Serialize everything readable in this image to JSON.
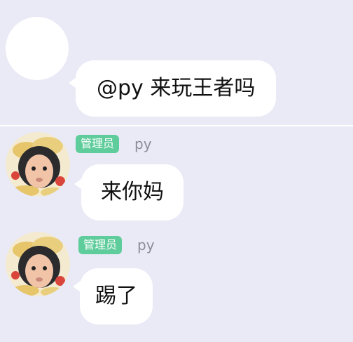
{
  "colors": {
    "background": "#e9eaf6",
    "bubble": "#ffffff",
    "role_badge": "#5fcc9b",
    "nickname": "#8d8d99"
  },
  "messages": [
    {
      "avatar": "blank-avatar-icon",
      "text": "@py 来玩王者吗"
    },
    {
      "avatar": "baby-avatar-icon",
      "role_badge": "管理员",
      "nickname": "py",
      "text": "来你妈"
    },
    {
      "avatar": "baby-avatar-icon",
      "role_badge": "管理员",
      "nickname": "py",
      "text": "踢了"
    }
  ]
}
